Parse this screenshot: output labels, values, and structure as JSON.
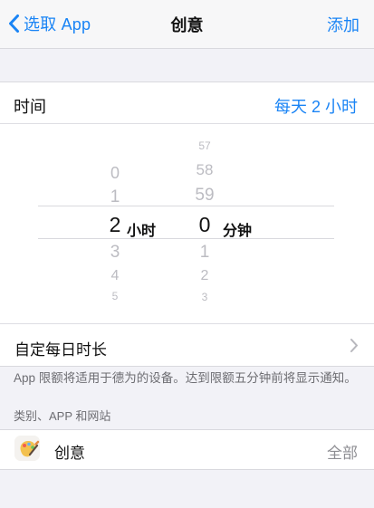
{
  "colors": {
    "background": "#f2f2f7",
    "accent": "#1a84f5",
    "secondary_text": "#6d6d72",
    "muted_text": "#8e8e93"
  },
  "navigation": {
    "back_label": "选取 App",
    "title": "创意",
    "add_label": "添加",
    "back_icon": "chevron-left-icon"
  },
  "time_limit": {
    "label": "时间",
    "value": "每天 2 小时"
  },
  "picker": {
    "hours": {
      "items": [
        "0",
        "1",
        "2",
        "3",
        "4",
        "5"
      ],
      "selected": "2",
      "unit": "小时"
    },
    "minutes": {
      "items": [
        "57",
        "58",
        "59",
        "0",
        "1",
        "2",
        "3"
      ],
      "selected": "0",
      "unit": "分钟"
    }
  },
  "custom_daily": {
    "label": "自定每日时长",
    "icon": "chevron-right-icon"
  },
  "limit_note": "App 限额将适用于德为的设备。达到限额五分钟前将显示通知。",
  "section": {
    "title": "类别、APP 和网站"
  },
  "category": {
    "icon": "creativity-palette-icon",
    "label": "创意",
    "value": "全部"
  }
}
